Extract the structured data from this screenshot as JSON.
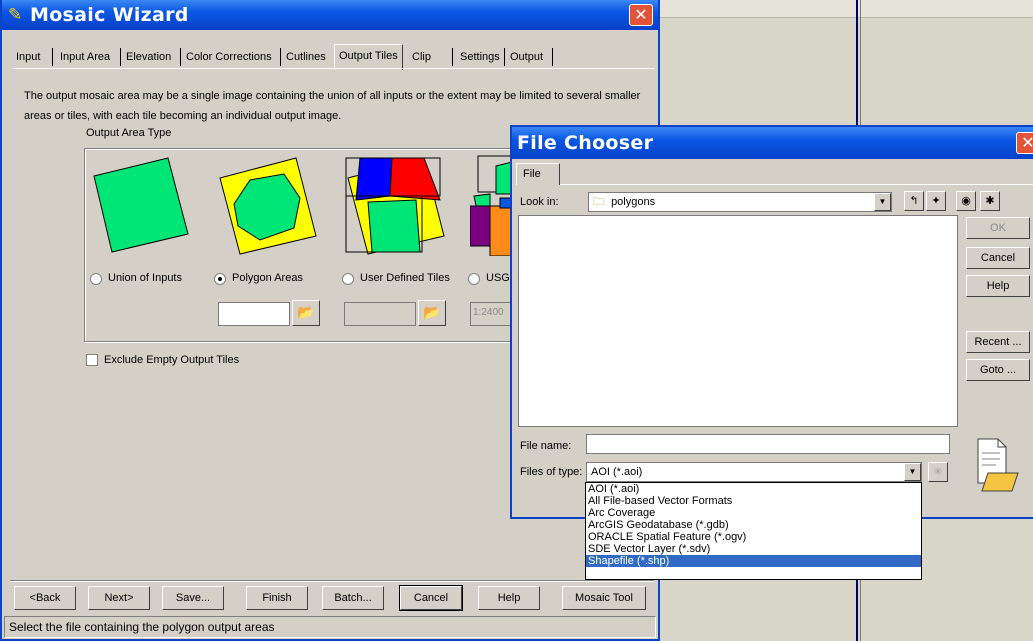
{
  "mosaic": {
    "title": "Mosaic Wizard",
    "close_glyph": "✕",
    "tabs": [
      "Input",
      "Input Area",
      "Elevation",
      "Color Corrections",
      "Cutlines",
      "Output Tiles",
      "Clip",
      "Settings",
      "Output"
    ],
    "active_tab": "Output Tiles",
    "description": "The output mosaic area may be a single image containing the union of all inputs or the extent may be limited to several smaller areas or tiles, with each tile becoming an individual output image.",
    "output_area_type_label": "Output Area Type",
    "options": {
      "union": "Union of Inputs",
      "polygon": "Polygon Areas",
      "user_tiles": "User Defined Tiles",
      "usgs": "USG"
    },
    "usgs_field_value": "1:2400",
    "exclude_empty_label": "Exclude Empty Output Tiles",
    "buttons": {
      "back": "<Back",
      "next": "Next>",
      "save": "Save...",
      "finish": "Finish",
      "batch": "Batch...",
      "cancel": "Cancel",
      "help": "Help",
      "mosaic_tool": "Mosaic Tool"
    },
    "status": "Select the file containing the polygon output areas"
  },
  "file_chooser": {
    "title": "File Chooser",
    "tab": "File",
    "look_in_label": "Look in:",
    "look_in_value": "polygons",
    "buttons": {
      "ok": "OK",
      "cancel": "Cancel",
      "help": "Help",
      "recent": "Recent ...",
      "goto": "Goto ..."
    },
    "file_name_label": "File name:",
    "file_name_value": "",
    "files_of_type_label": "Files of type:",
    "files_of_type_value": "AOI (*.aoi)",
    "type_options": [
      "AOI (*.aoi)",
      "All File-based Vector Formats",
      "Arc Coverage",
      "ArcGIS Geodatabase (*.gdb)",
      "ORACLE Spatial Feature (*.ogv)",
      "SDE Vector Layer (*.sdv)",
      "Shapefile (*.shp)"
    ],
    "selected_type_option": "Shapefile (*.shp)"
  },
  "colors": {
    "title_blue": "#0a57e3",
    "dialog_gray": "#d4d0c8",
    "shape_green": "#00e676",
    "shape_yellow": "#ffff00",
    "selection_blue": "#316ac5"
  }
}
